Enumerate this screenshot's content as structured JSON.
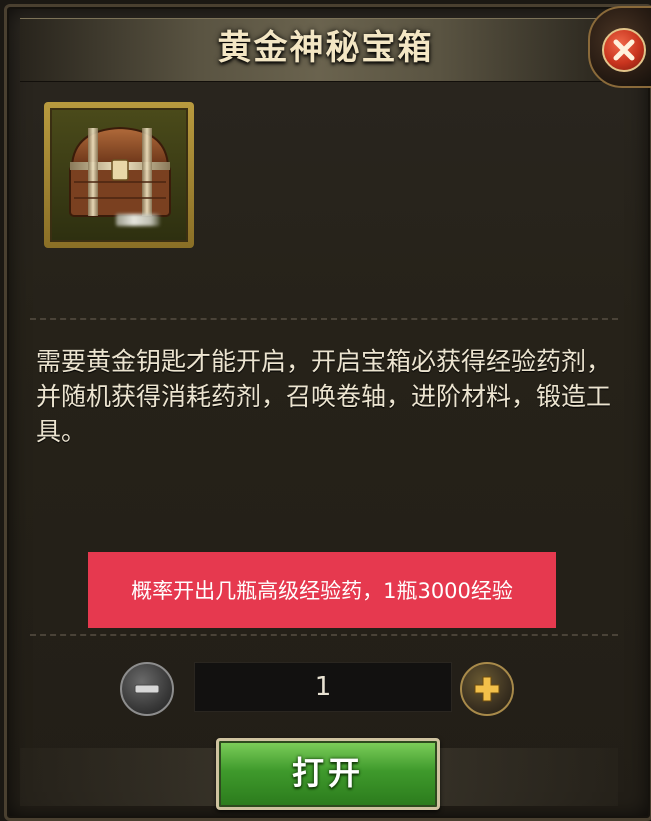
{
  "dialog": {
    "title": "黄金神秘宝箱",
    "close_icon": "close-icon",
    "item_icon": "treasure-chest-icon",
    "description": "需要黄金钥匙才能开启，开启宝箱必获得经验药剂，并随机获得消耗药剂，召唤卷轴，进阶材料，锻造工具。",
    "annotation": "概率开出几瓶高级经验药，1瓶3000经验",
    "quantity": {
      "value": "1",
      "minus_icon": "minus-icon",
      "plus_icon": "plus-icon"
    },
    "open_label": "打开"
  },
  "colors": {
    "panel_bg": "#252119",
    "annotation_bg": "#e6394f",
    "open_button": "#3f9a2c",
    "item_frame": "#b89a3e"
  }
}
